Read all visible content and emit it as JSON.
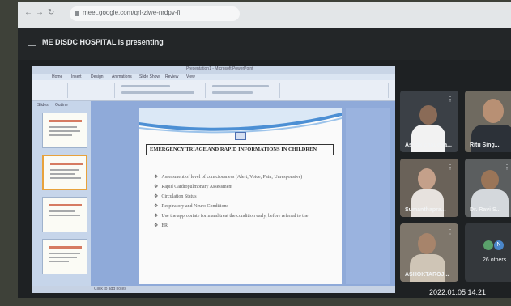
{
  "browser": {
    "url": "meet.google.com/qrl-ziwe-nrdpv-fi"
  },
  "presenting": {
    "text": "ME DISDC HOSPITAL is presenting"
  },
  "powerpoint": {
    "window_title": "Presentation1 - Microsoft PowerPoint",
    "menu": [
      "Home",
      "Insert",
      "Design",
      "Animations",
      "Slide Show",
      "Review",
      "View"
    ],
    "panel_tabs": [
      "Slides",
      "Outline"
    ],
    "status": "Click to add notes"
  },
  "slide": {
    "heading": "EMERGENCY TRIAGE AND RAPID INFORMATIONS IN CHILDREN",
    "bullets": [
      "Assessment of level of consciousness (Alert, Voice, Pain, Unresponsive)",
      "Rapid Cardiopulmonary Assessment",
      "Circulation Status",
      "Respiratory and Neuro Conditions",
      "Use the appropriate form and treat the condition early, before referral to the",
      "ER"
    ]
  },
  "participants": [
    {
      "name": "Ashok chaudha...",
      "mic": "⋮",
      "skin": "#8a6b57",
      "shirt": "#f2f2f2",
      "bg": "#3b4046"
    },
    {
      "name": "Ritu Sing...",
      "mic": "",
      "skin": "#b89074",
      "shirt": "#2c3138",
      "bg": "#6f6a60"
    },
    {
      "name": "Sumanthapra...",
      "mic": "⋮",
      "skin": "#c4a08a",
      "shirt": "#e7e2de",
      "bg": "#6a6259"
    },
    {
      "name": "Dr. Ravi S...",
      "mic": "⋮",
      "skin": "#9a7558",
      "shirt": "#d4d8dc",
      "bg": "#5b5e5f"
    },
    {
      "name": "ASHOKTAROJ...",
      "mic": "⋮",
      "skin": "#a7846b",
      "shirt": "#cfc5b6",
      "bg": "#7e766b"
    }
  ],
  "others": {
    "label": "26 others",
    "avatar_letter": "N"
  },
  "timestamp": "2022.01.05 14:21",
  "colors": {
    "slide_accent": "#4c8fd4",
    "ppt_blue": "#8faad9"
  }
}
